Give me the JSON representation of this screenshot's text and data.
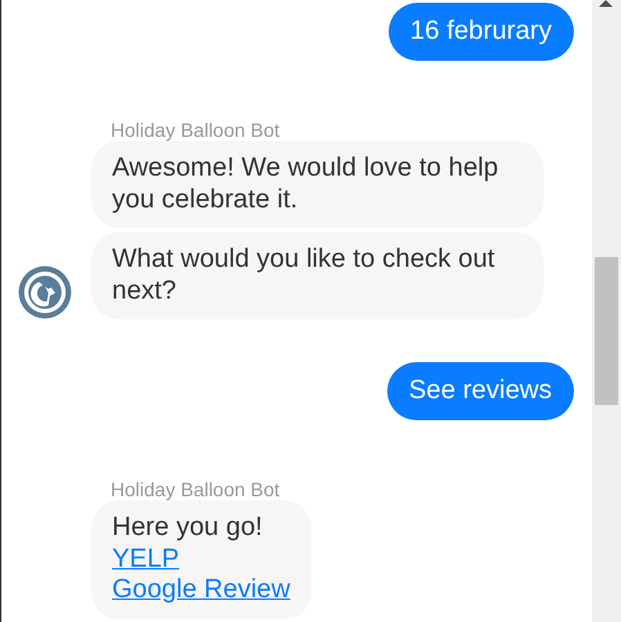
{
  "messages": [
    {
      "kind": "user",
      "text": "16 februrary"
    },
    {
      "kind": "bot",
      "sender": "Holiday Balloon Bot",
      "avatar": true,
      "bubbles": [
        {
          "parts": [
            {
              "kind": "text",
              "text": "Awesome! We would love to help you celebrate it."
            }
          ]
        },
        {
          "parts": [
            {
              "kind": "text",
              "text": "What would you like to check out next?"
            }
          ]
        }
      ]
    },
    {
      "kind": "user",
      "text": "See reviews"
    },
    {
      "kind": "bot",
      "sender": "Holiday Balloon Bot",
      "avatar": false,
      "bubbles": [
        {
          "parts": [
            {
              "kind": "text",
              "text": "Here you go!"
            },
            {
              "kind": "link",
              "text": "YELP"
            },
            {
              "kind": "link",
              "text": "Google Review"
            }
          ]
        }
      ]
    }
  ]
}
